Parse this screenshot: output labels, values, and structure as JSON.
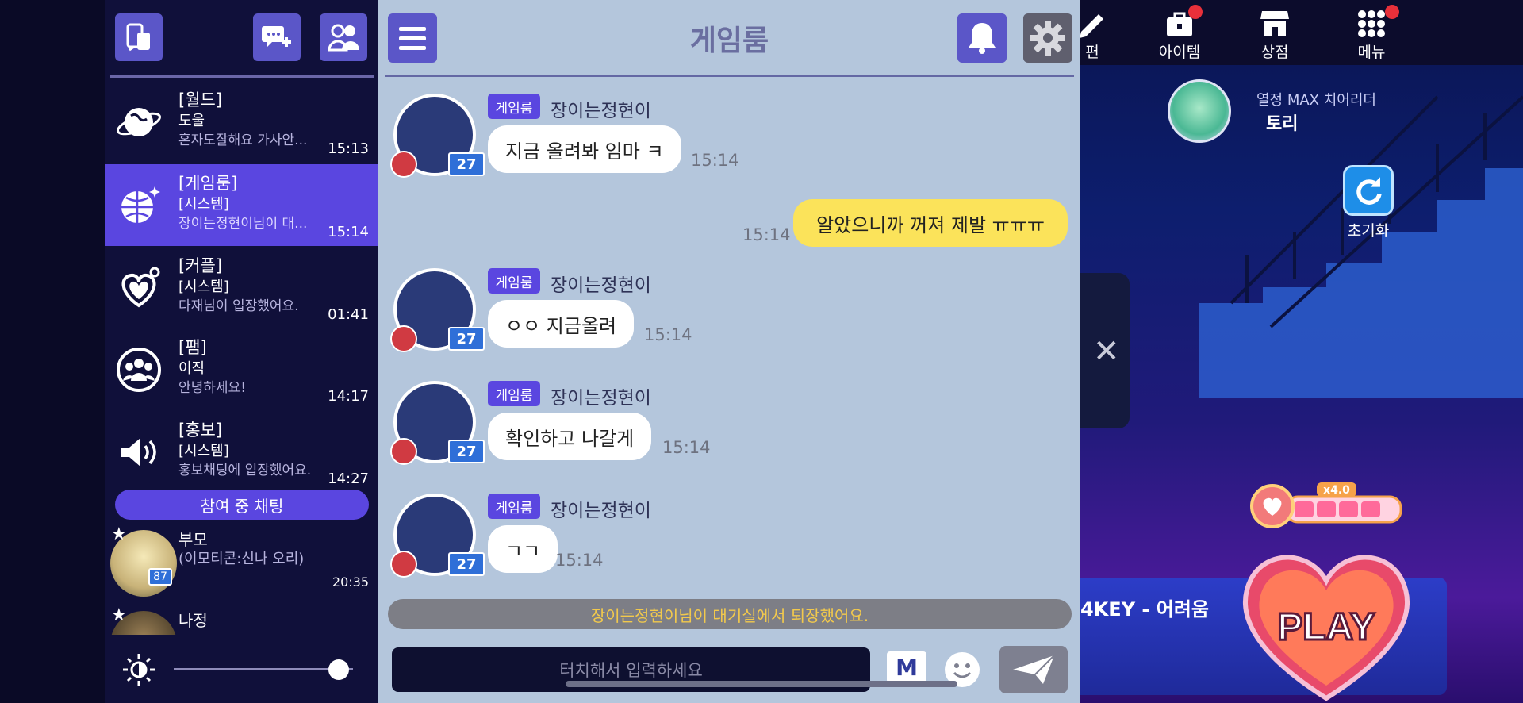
{
  "sidebar": {
    "rooms": [
      {
        "name": "[월드]",
        "who": "도울",
        "msg": "혼자도잘해요 가사안...",
        "time": "15:13"
      },
      {
        "name": "[게임룸]",
        "who": "[시스템]",
        "msg": "장이는정현이님이 대...",
        "time": "15:14"
      },
      {
        "name": "[커플]",
        "who": "[시스템]",
        "msg": "다재님이 입장했어요.",
        "time": "01:41"
      },
      {
        "name": "[팸]",
        "who": "이직",
        "msg": "안녕하세요!",
        "time": "14:17"
      },
      {
        "name": "[홍보]",
        "who": "[시스템]",
        "msg": "홍보채팅에 입장했어요.",
        "time": "14:27"
      }
    ],
    "participating_label": "참여 중 채팅",
    "friends": [
      {
        "name": "부모",
        "status": "(이모티콘:신나 오리)",
        "time": "20:35",
        "level": "87"
      },
      {
        "name": "나정",
        "status": "",
        "time": "",
        "level": ""
      }
    ],
    "brightness": 0.92
  },
  "chat": {
    "title": "게임룸",
    "messages": [
      {
        "badge": "게임룸",
        "name": "장이는정현이",
        "level": "27",
        "text": "지금 올려봐 임마 ㅋ",
        "time": "15:14"
      },
      {
        "badge": "게임룸",
        "name": "장이는정현이",
        "level": "27",
        "text": "ㅇㅇ 지금올려",
        "time": "15:14"
      },
      {
        "badge": "게임룸",
        "name": "장이는정현이",
        "level": "27",
        "text": "확인하고 나갈게",
        "time": "15:14"
      },
      {
        "badge": "게임룸",
        "name": "장이는정현이",
        "level": "27",
        "text": "ㄱㄱ",
        "time": "15:14"
      }
    ],
    "my_message": {
      "text": "알았으니까 꺼져 제발 ㅠㅠㅠ",
      "time": "15:14"
    },
    "system_notice": "장이는정현이님이 대기실에서 퇴장했어요.",
    "input_placeholder": "터치해서 입력하세요",
    "m_label": "M"
  },
  "game": {
    "top_menu": [
      {
        "label": "편",
        "icon": "edit-icon"
      },
      {
        "label": "아이템",
        "icon": "item-bag-icon"
      },
      {
        "label": "상점",
        "icon": "shop-icon"
      },
      {
        "label": "메뉴",
        "icon": "menu-grid-icon"
      }
    ],
    "profile_title": "열정 MAX 치어리더",
    "profile_name": "토리",
    "reset_label": "초기화",
    "song_text": "4KEY - 어려움",
    "combo_multiplier": "x4.0",
    "play_label": "PLAY"
  }
}
